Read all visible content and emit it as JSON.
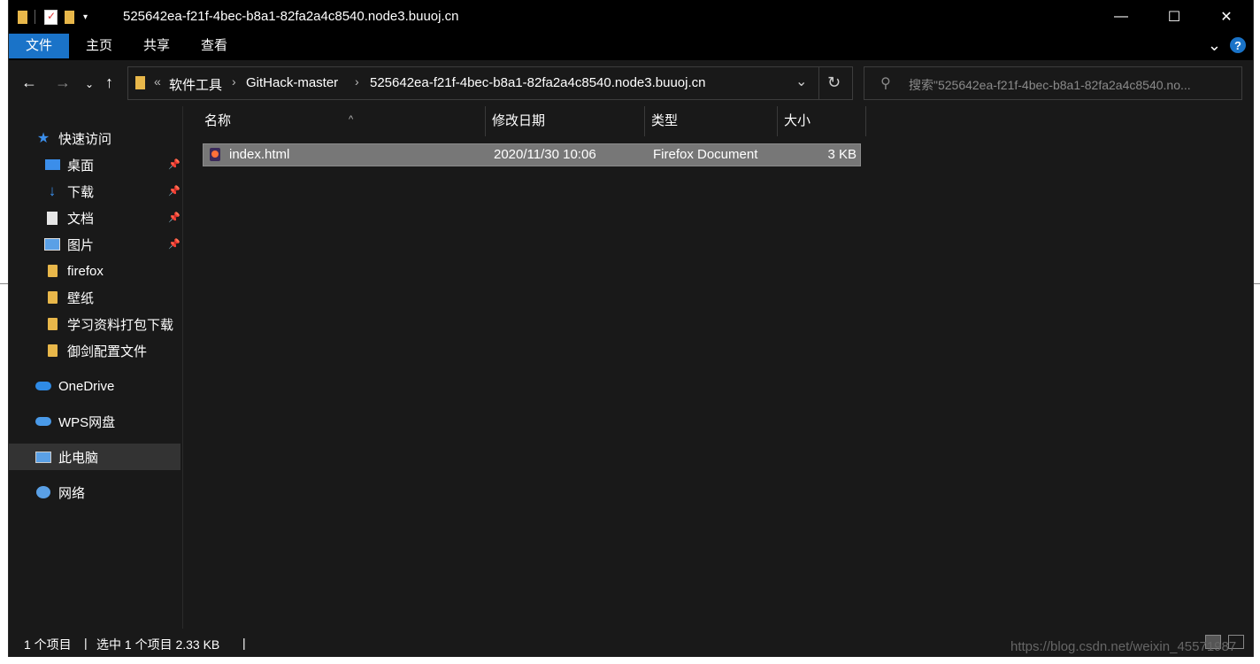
{
  "window": {
    "title": "525642ea-f21f-4bec-b8a1-82fa2a4c8540.node3.buuoj.cn",
    "minimize_glyph": "—",
    "maximize_glyph": "☐",
    "close_glyph": "✕"
  },
  "ribbon": {
    "tabs": [
      {
        "label": "文件",
        "active": true
      },
      {
        "label": "主页",
        "active": false
      },
      {
        "label": "共享",
        "active": false
      },
      {
        "label": "查看",
        "active": false
      }
    ],
    "expand_glyph": "⌄",
    "help_label": "?"
  },
  "address": {
    "overflow_label": "«",
    "crumbs": [
      "软件工具",
      "GitHack-master",
      "525642ea-f21f-4bec-b8a1-82fa2a4c8540.node3.buuoj.cn"
    ],
    "separator": "›",
    "search_placeholder": "搜索\"525642ea-f21f-4bec-b8a1-82fa2a4c8540.no..."
  },
  "sidebar": {
    "quick_access": "快速访问",
    "items": [
      {
        "label": "桌面",
        "icon": "desktop-icon",
        "pinned": true
      },
      {
        "label": "下载",
        "icon": "download-icon",
        "pinned": true
      },
      {
        "label": "文档",
        "icon": "document-icon",
        "pinned": true
      },
      {
        "label": "图片",
        "icon": "picture-icon",
        "pinned": true
      },
      {
        "label": "firefox",
        "icon": "folder-icon",
        "pinned": false
      },
      {
        "label": "壁纸",
        "icon": "folder-icon",
        "pinned": false
      },
      {
        "label": "学习资料打包下载",
        "icon": "folder-icon",
        "pinned": false
      },
      {
        "label": "御剑配置文件",
        "icon": "folder-icon",
        "pinned": false
      }
    ],
    "onedrive": "OneDrive",
    "wps": "WPS网盘",
    "this_pc": "此电脑",
    "network": "网络"
  },
  "columns": {
    "name": "名称",
    "modified": "修改日期",
    "type": "类型",
    "size": "大小"
  },
  "files": [
    {
      "name": "index.html",
      "modified": "2020/11/30 10:06",
      "type": "Firefox Document",
      "size": "3 KB"
    }
  ],
  "status": {
    "count": "1 个项目",
    "selected": "选中 1 个项目  2.33 KB"
  },
  "watermark": "https://blog.csdn.net/weixin_45571987",
  "colors": {
    "accent": "#1a73c8",
    "background": "#191919",
    "selection": "#777777",
    "folder": "#e8b74a"
  }
}
